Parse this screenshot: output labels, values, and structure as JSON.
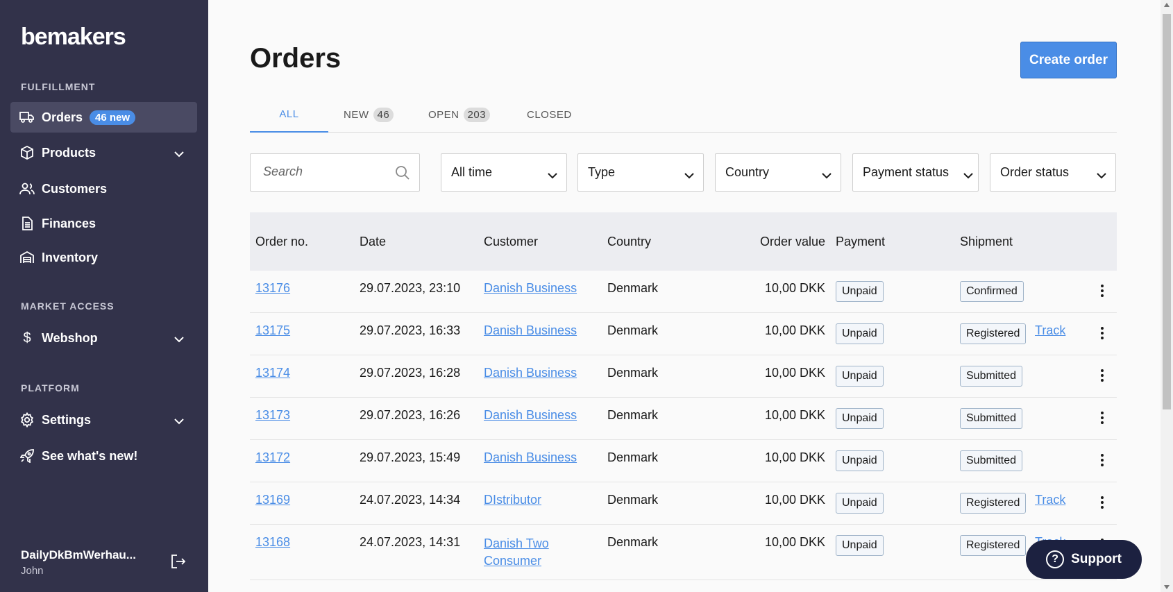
{
  "sidebar": {
    "logo": "bemakers",
    "sections": {
      "fulfillment": "FULFILLMENT",
      "market_access": "MARKET ACCESS",
      "platform": "PLATFORM"
    },
    "items": {
      "orders": "Orders",
      "orders_badge": "46 new",
      "products": "Products",
      "customers": "Customers",
      "finances": "Finances",
      "inventory": "Inventory",
      "webshop": "Webshop",
      "settings": "Settings",
      "whats_new": "See what's new!"
    },
    "user": {
      "name": "DailyDkBmWerhau...",
      "sub": "John"
    }
  },
  "main": {
    "title": "Orders",
    "create_button": "Create order",
    "tabs": {
      "all": "ALL",
      "new": "NEW",
      "new_count": "46",
      "open": "OPEN",
      "open_count": "203",
      "closed": "CLOSED"
    },
    "search_placeholder": "Search",
    "filters": {
      "time": "All time",
      "type": "Type",
      "country": "Country",
      "payment": "Payment status",
      "order_status": "Order status"
    },
    "columns": {
      "order_no": "Order no.",
      "date": "Date",
      "customer": "Customer",
      "country": "Country",
      "order_value": "Order value",
      "payment": "Payment",
      "shipment": "Shipment"
    },
    "rows": [
      {
        "order": "13176",
        "date": "29.07.2023, 23:10",
        "customer": "Danish Business",
        "country": "Denmark",
        "value": "10,00 DKK",
        "payment": "Unpaid",
        "shipment": "Confirmed",
        "track": ""
      },
      {
        "order": "13175",
        "date": "29.07.2023, 16:33",
        "customer": "Danish Business",
        "country": "Denmark",
        "value": "10,00 DKK",
        "payment": "Unpaid",
        "shipment": "Registered",
        "track": "Track"
      },
      {
        "order": "13174",
        "date": "29.07.2023, 16:28",
        "customer": "Danish Business",
        "country": "Denmark",
        "value": "10,00 DKK",
        "payment": "Unpaid",
        "shipment": "Submitted",
        "track": ""
      },
      {
        "order": "13173",
        "date": "29.07.2023, 16:26",
        "customer": "Danish Business",
        "country": "Denmark",
        "value": "10,00 DKK",
        "payment": "Unpaid",
        "shipment": "Submitted",
        "track": ""
      },
      {
        "order": "13172",
        "date": "29.07.2023, 15:49",
        "customer": "Danish Business",
        "country": "Denmark",
        "value": "10,00 DKK",
        "payment": "Unpaid",
        "shipment": "Submitted",
        "track": ""
      },
      {
        "order": "13169",
        "date": "24.07.2023, 14:34",
        "customer": "DIstributor",
        "country": "Denmark",
        "value": "10,00 DKK",
        "payment": "Unpaid",
        "shipment": "Registered",
        "track": "Track"
      },
      {
        "order": "13168",
        "date": "24.07.2023, 14:31",
        "customer": "Danish Two Consumer",
        "country": "Denmark",
        "value": "10,00 DKK",
        "payment": "Unpaid",
        "shipment": "Registered",
        "track": "Track"
      }
    ]
  },
  "support_button": "Support",
  "colors": {
    "sidebar_bg": "#32324a",
    "accent": "#4a8de6",
    "support_bg": "#1c2140"
  }
}
